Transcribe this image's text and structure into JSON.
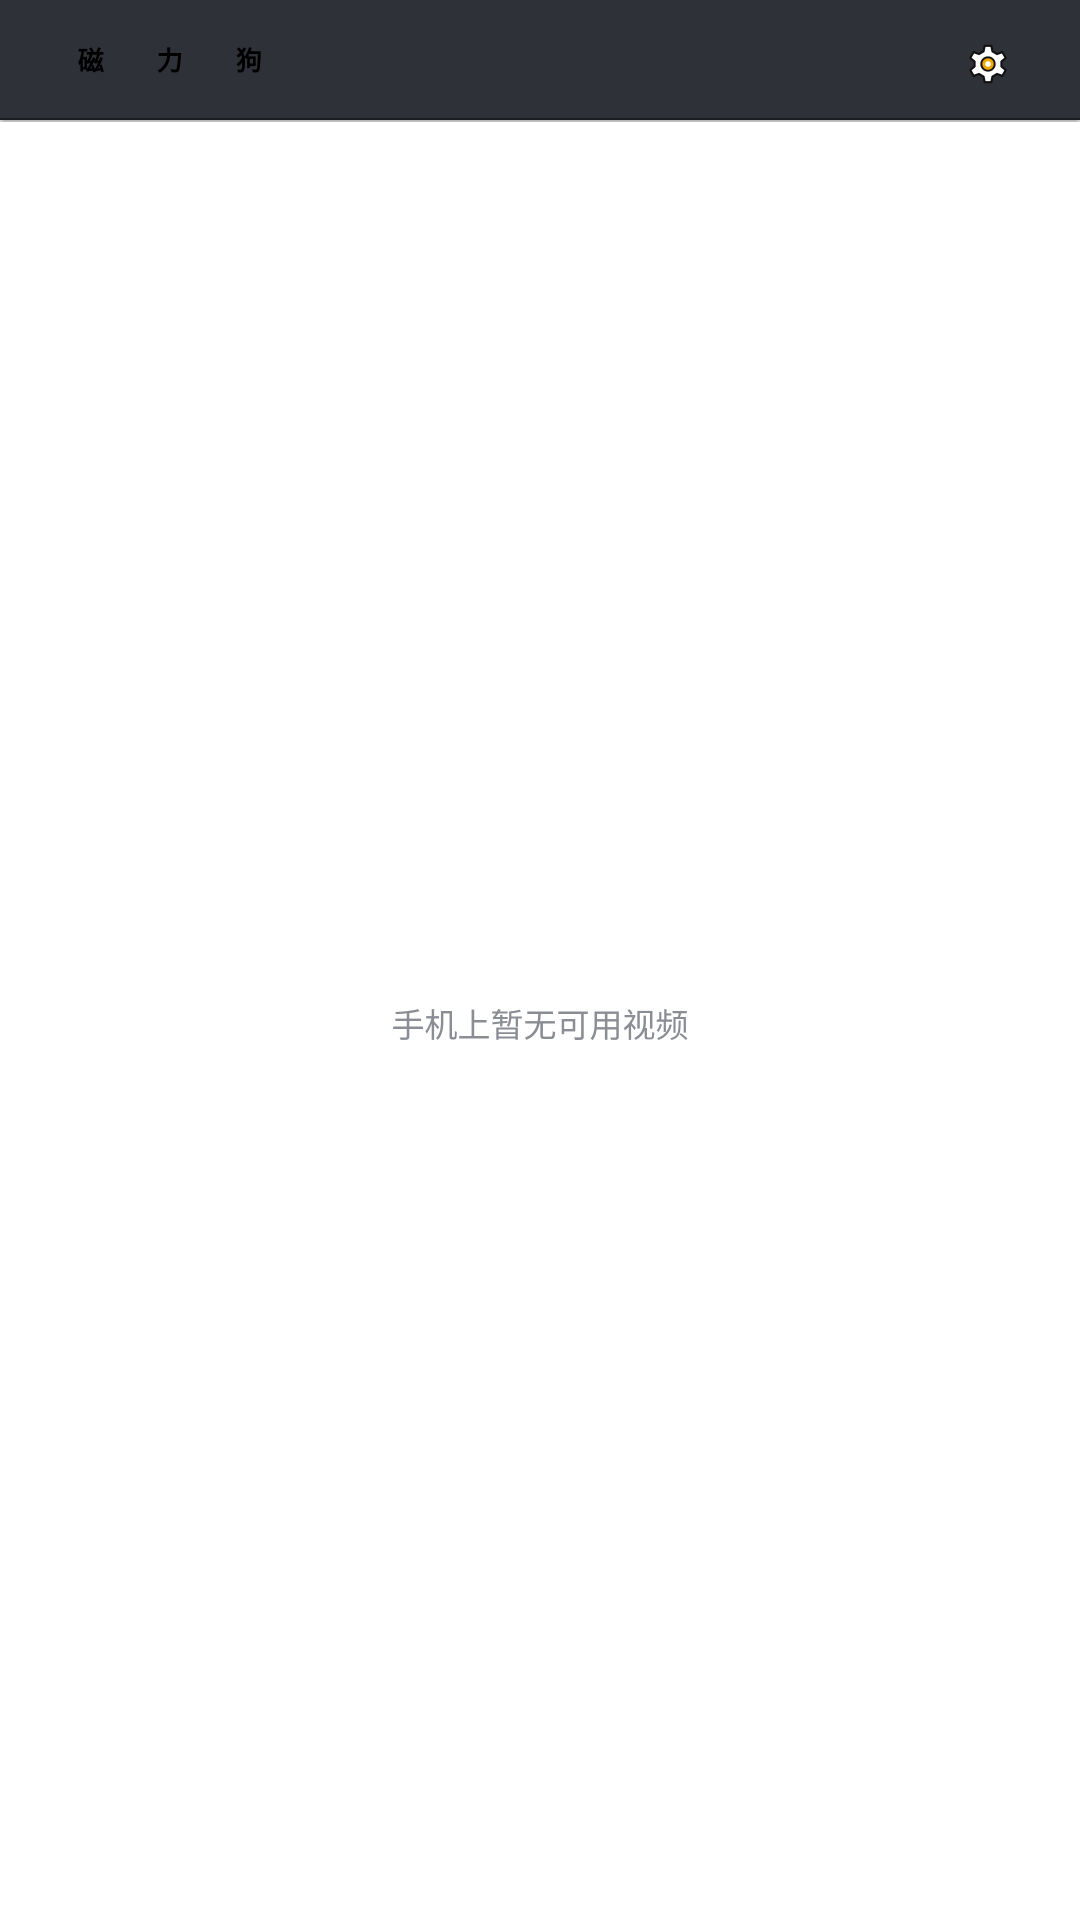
{
  "app_bar": {
    "title": "磁 力 狗",
    "settings_icon": "gear-icon",
    "background_color": "#2e3138",
    "icon_accent_color": "#f0a800"
  },
  "content": {
    "empty_message": "手机上暂无可用视频"
  }
}
